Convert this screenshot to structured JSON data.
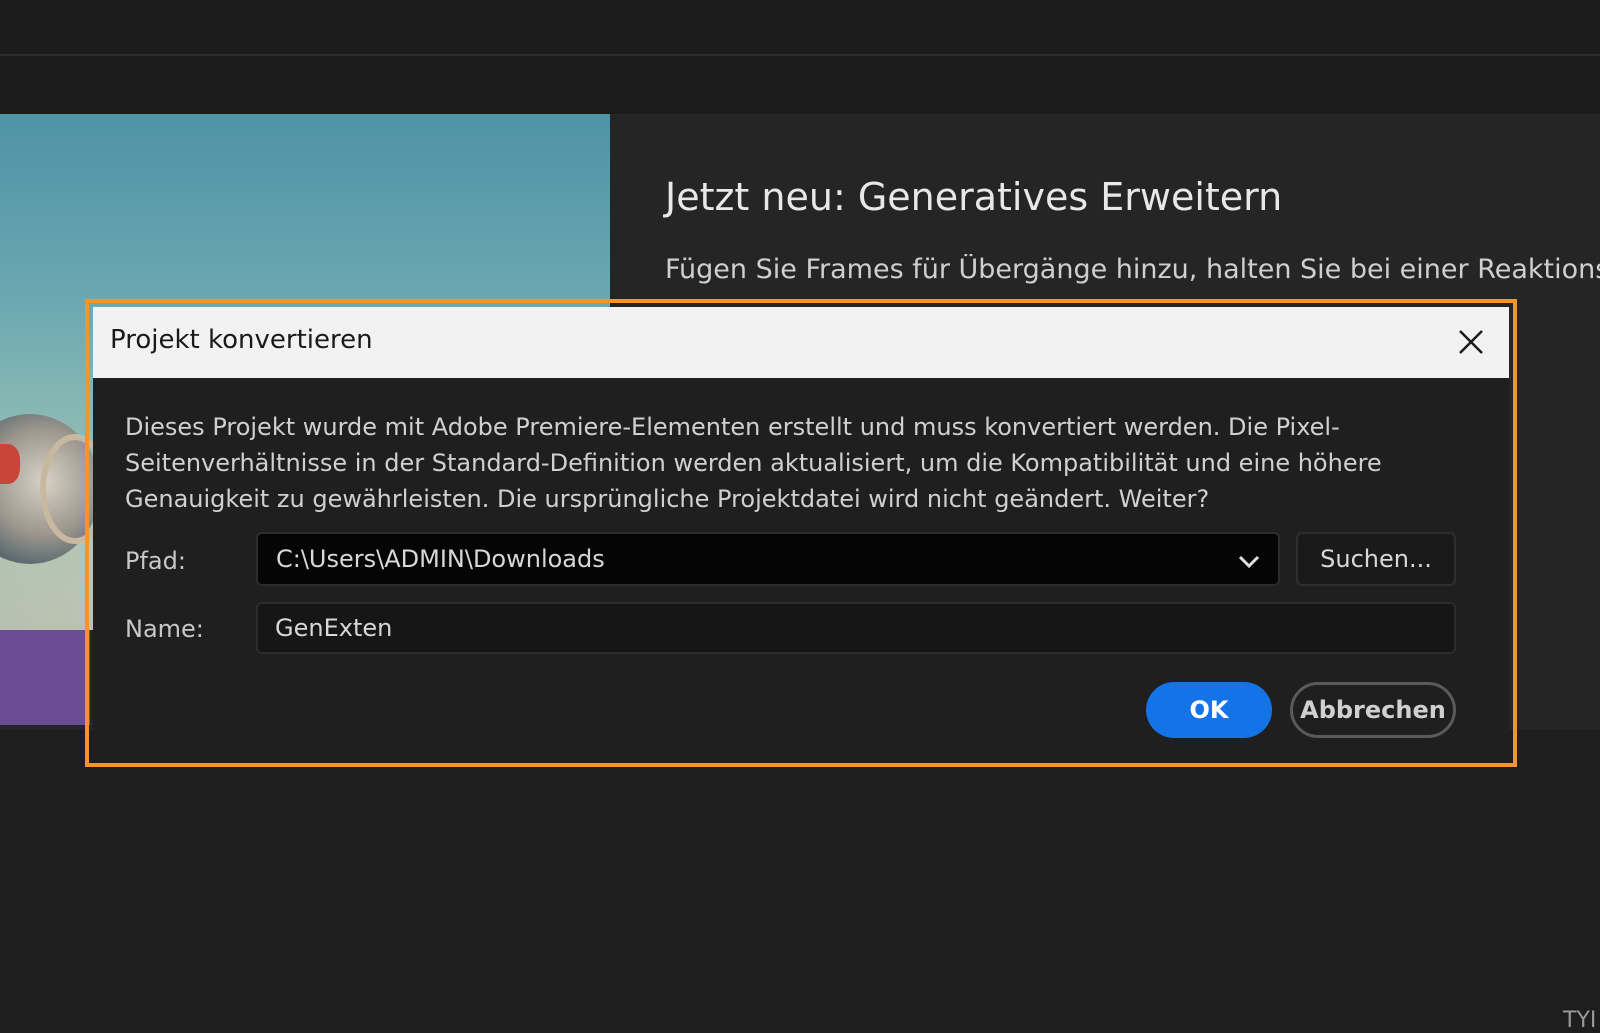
{
  "background": {
    "topbar_fragment": "",
    "headline": "Jetzt neu: Generatives Erweitern",
    "hero_text": "Fügen Sie Frames für Übergänge hinzu, halten Sie bei einer Reaktionseins",
    "corner_text": "TYI"
  },
  "dialog": {
    "title": "Projekt konvertieren",
    "message": "Dieses Projekt wurde mit Adobe Premiere-Elementen erstellt und muss konvertiert werden. Die Pixel-Seitenverhältnisse in der Standard-Definition werden aktualisiert, um die Kompatibilität und eine höhere Genauigkeit zu gewährleisten. Die ursprüngliche Projektdatei wird nicht geändert. Weiter?",
    "path_label": "Pfad:",
    "path_value": "C:\\Users\\ADMIN\\Downloads",
    "browse_label": "Suchen...",
    "name_label": "Name:",
    "name_value": "GenExten",
    "ok_label": "OK",
    "cancel_label": "Abbrechen"
  },
  "colors": {
    "highlight_frame": "#f0962a",
    "primary_button": "#1473e6"
  }
}
